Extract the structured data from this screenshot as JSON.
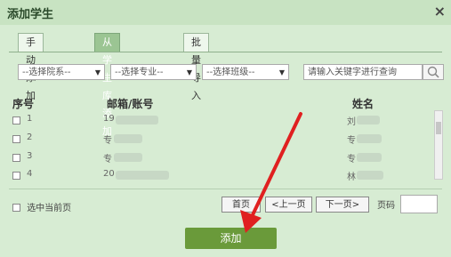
{
  "dialog": {
    "title": "添加学生",
    "close_label": "×"
  },
  "tabs": [
    {
      "label": "手动添加",
      "active": false
    },
    {
      "label": "从学生库添加",
      "active": true
    },
    {
      "label": "批量导入",
      "active": false
    }
  ],
  "filters": {
    "department": "--选择院系--",
    "major": "--选择专业--",
    "class": "--选择班级--",
    "search_placeholder": "请输入关键字进行查询"
  },
  "table": {
    "headers": {
      "index": "序号",
      "email": "邮箱/账号",
      "name": "姓名"
    },
    "rows": [
      {
        "index": "1",
        "email": "19",
        "name": "刘"
      },
      {
        "index": "2",
        "email": "专",
        "name": "专"
      },
      {
        "index": "3",
        "email": "专",
        "name": "专"
      },
      {
        "index": "4",
        "email": "20",
        "name": "林"
      }
    ]
  },
  "footer": {
    "select_page_label": "选中当前页",
    "first_label": "首页",
    "prev_label": "<上一页",
    "next_label": "下一页>",
    "page_label": "页码",
    "page_value": ""
  },
  "add_button_label": "添加",
  "colors": {
    "accent": "#6a9a3a",
    "tab_active": "#9bc593",
    "annotation_arrow": "#e02020"
  }
}
